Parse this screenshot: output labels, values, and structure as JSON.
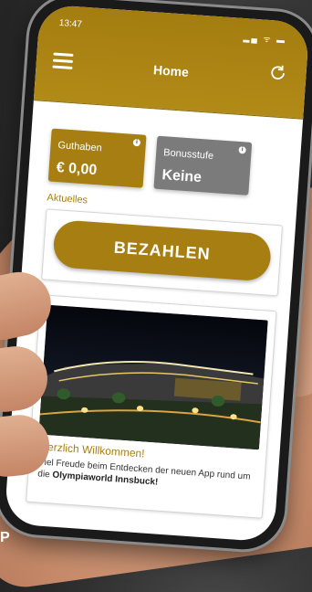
{
  "statusbar": {
    "time": "13:47",
    "icons": "▂▄ ᯤ ▬"
  },
  "header": {
    "title": "Home"
  },
  "tiles": [
    {
      "label": "Guthaben",
      "value": "€ 0,00"
    },
    {
      "label": "Bonusstufe",
      "value": "Keine"
    }
  ],
  "section": {
    "label": "Aktuelles"
  },
  "pay_button": {
    "label": "BEZAHLEN"
  },
  "news": {
    "title": "Herzlich Willkommen!",
    "text": "Viel Freude beim Entdecken der neuen App rund um die",
    "bold": "Olympiaworld Innsbuck!"
  },
  "corner_text": "P",
  "colors": {
    "brand": "#a77e12",
    "tile_grey": "#7b7b7b"
  }
}
